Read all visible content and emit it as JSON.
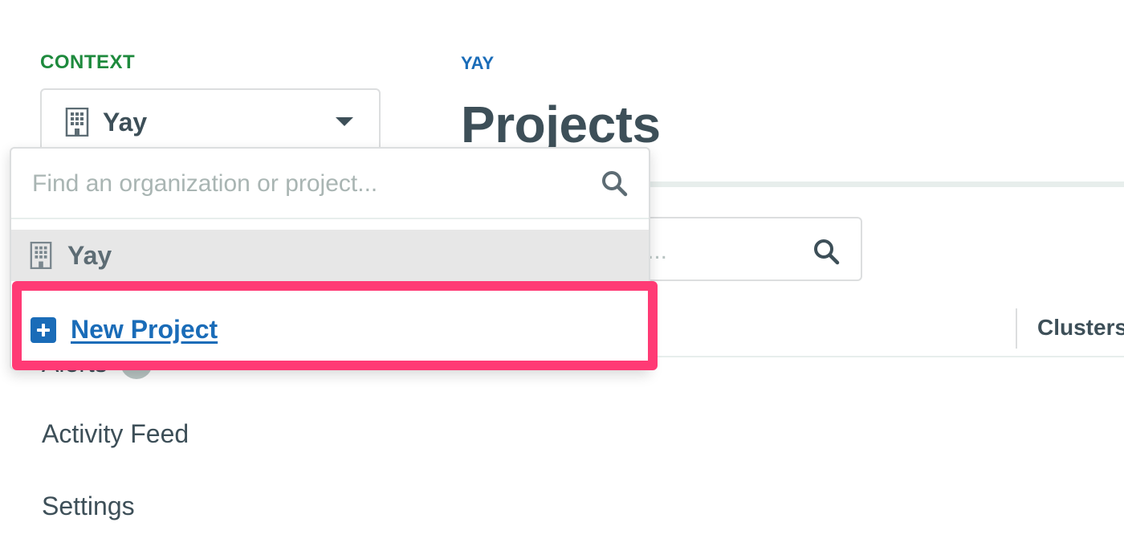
{
  "sidebar": {
    "context_label": "CONTEXT",
    "selected_context": "Yay",
    "nav": {
      "alerts": "Alerts",
      "activity_feed": "Activity Feed",
      "settings": "Settings"
    }
  },
  "main": {
    "breadcrumb": "YAY",
    "title": "Projects",
    "search_fragment": "...",
    "table_headers": [
      "Clusters"
    ]
  },
  "dropdown": {
    "search_placeholder": "Find an organization or project...",
    "organization": "Yay",
    "new_project_label": "New Project"
  },
  "colors": {
    "context_label": "#1e8a3d",
    "link": "#1a6cb8",
    "highlight": "#ff3a75",
    "text": "#3d4f58"
  },
  "icons": [
    "building-icon",
    "chevron-down-icon",
    "search-icon",
    "plus-square-icon"
  ]
}
